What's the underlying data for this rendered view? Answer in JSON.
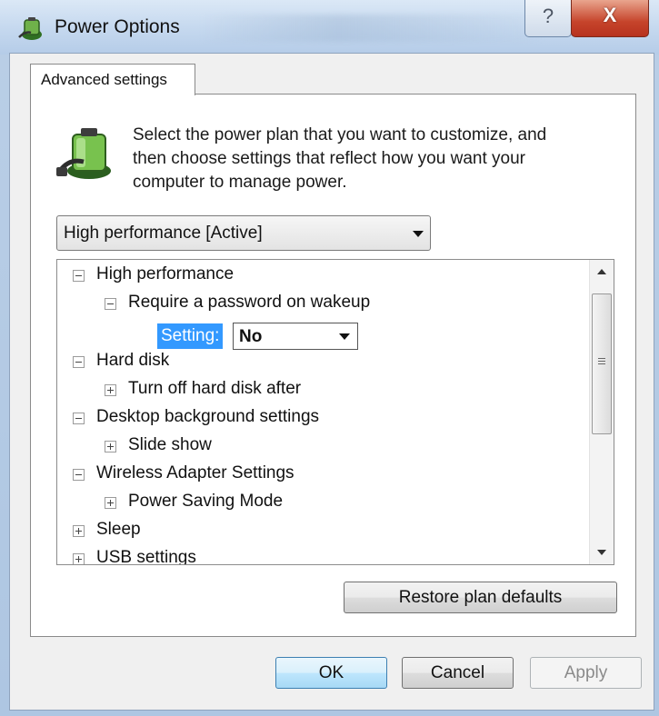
{
  "window": {
    "title": "Power Options",
    "help_glyph": "?",
    "close_glyph": "X"
  },
  "tab": {
    "label": "Advanced settings"
  },
  "intro": {
    "line1": "Select the power plan that you want to customize, and",
    "line2": "then choose settings that reflect how you want your",
    "line3": "computer to manage power."
  },
  "plan_select": {
    "value": "High performance [Active]"
  },
  "tree": {
    "items": [
      {
        "label": "High performance",
        "expander": "minus",
        "level": 0
      },
      {
        "label": "Require a password on wakeup",
        "expander": "minus",
        "level": 1
      },
      {
        "label": "Hard disk",
        "expander": "minus",
        "level": 0
      },
      {
        "label": "Turn off hard disk after",
        "expander": "plus",
        "level": 1
      },
      {
        "label": "Desktop background settings",
        "expander": "minus",
        "level": 0
      },
      {
        "label": "Slide show",
        "expander": "plus",
        "level": 1
      },
      {
        "label": "Wireless Adapter Settings",
        "expander": "minus",
        "level": 0
      },
      {
        "label": "Power Saving Mode",
        "expander": "plus",
        "level": 1
      },
      {
        "label": "Sleep",
        "expander": "plus",
        "level": 0
      },
      {
        "label": "USB settings",
        "expander": "plus",
        "level": 0
      }
    ],
    "setting_label": "Setting:",
    "setting_value": "No"
  },
  "buttons": {
    "restore": "Restore plan defaults",
    "ok": "OK",
    "cancel": "Cancel",
    "apply": "Apply"
  },
  "colors": {
    "selection": "#3399ff",
    "title_bar": "#c6d9ef",
    "close_button": "#c6442b"
  },
  "icons": {
    "app": "power-options-battery-plug-icon",
    "intro": "battery-plug-icon"
  }
}
